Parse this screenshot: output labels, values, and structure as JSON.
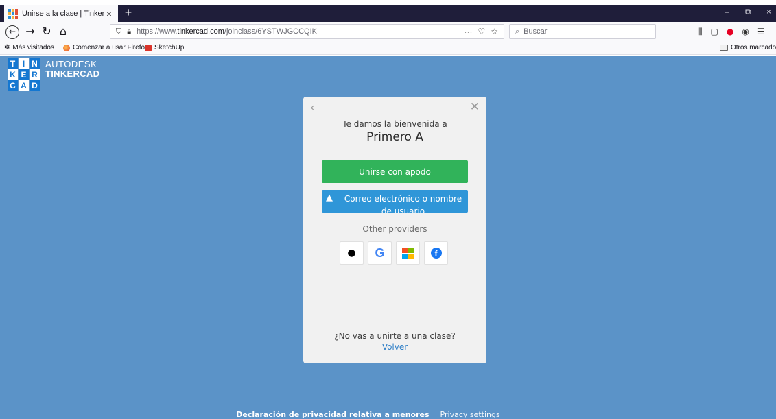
{
  "browser": {
    "tab_title": "Unirse a la clase | Tinkercad",
    "tab_close": "×",
    "new_tab": "+",
    "window_minimize": "–",
    "window_restore": "⧉",
    "window_close": "×",
    "url_prefix": "https://www.",
    "url_domain": "tinkercad.com",
    "url_path": "/joinclass/6YSTWJGCCQIK",
    "url_more": "···",
    "search_placeholder": "Buscar",
    "bookmarks": [
      "Más visitados",
      "Comenzar a usar Firefox",
      "SketchUp"
    ],
    "other_bookmarks": "Otros marcadores"
  },
  "logo": {
    "letters": [
      "T",
      "I",
      "N",
      "K",
      "E",
      "R",
      "C",
      "A",
      "D"
    ],
    "line1": "AUTODESK",
    "line2": "TINKERCAD"
  },
  "modal": {
    "back_glyph": "‹",
    "close_glyph": "✕",
    "welcome": "Te damos la bienvenida a",
    "class_name": "Primero A",
    "nickname_button": "Unirse con apodo",
    "email_button": "Correo electrónico o nombre de usuario",
    "other_providers": "Other providers",
    "providers": [
      "apple",
      "google",
      "microsoft",
      "facebook"
    ],
    "not_joining": "¿No vas a unirte a una clase?",
    "back_link": "Volver"
  },
  "footer": {
    "privacy": "Declaración de privacidad relativa a menores",
    "settings": "Privacy settings"
  },
  "colors": {
    "page_background": "#5b93c8",
    "nickname_button": "#31b35a",
    "email_button": "#2f96d8",
    "link": "#2f7fc7"
  }
}
